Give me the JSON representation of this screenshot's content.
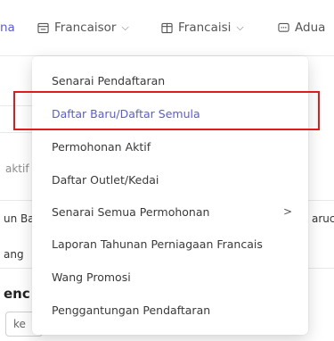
{
  "nav": {
    "items": [
      {
        "label": "na"
      },
      {
        "label": "Francaisor"
      },
      {
        "label": "Francaisi"
      },
      {
        "label": "Adua"
      }
    ]
  },
  "background": {
    "fragments": [
      "aktif",
      "un Ba",
      "aruc",
      "ang",
      "enc",
      "ke"
    ]
  },
  "dropdown": {
    "items": [
      {
        "label": "Senarai Pendaftaran"
      },
      {
        "label": "Daftar Baru/Daftar Semula"
      },
      {
        "label": "Permohonan Aktif"
      },
      {
        "label": "Daftar Outlet/Kedai"
      },
      {
        "label": "Senarai Semua Permohonan",
        "submenu_indicator": ">"
      },
      {
        "label": "Laporan Tahunan Perniagaan Francais"
      },
      {
        "label": "Wang Promosi"
      },
      {
        "label": "Penggantungan Pendaftaran"
      }
    ]
  },
  "colors": {
    "accent": "#5b5bd6",
    "highlight_border": "#e01b1b"
  }
}
